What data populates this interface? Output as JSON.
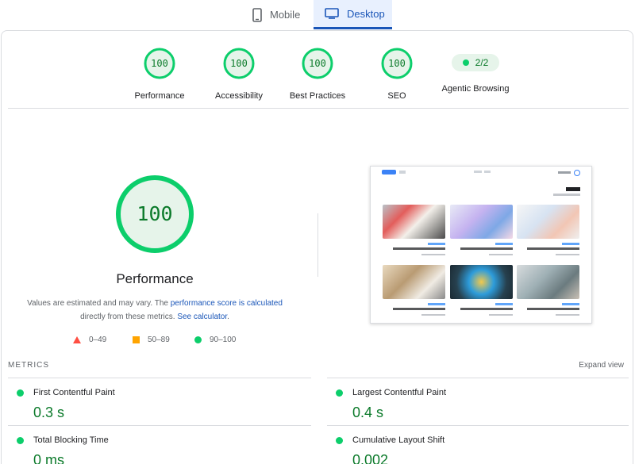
{
  "device_tabs": [
    {
      "label": "Mobile",
      "icon": "phone-icon",
      "selected": false
    },
    {
      "label": "Desktop",
      "icon": "monitor-icon",
      "selected": true
    }
  ],
  "categories": [
    {
      "label": "Performance",
      "score": "100"
    },
    {
      "label": "Accessibility",
      "score": "100"
    },
    {
      "label": "Best Practices",
      "score": "100"
    },
    {
      "label": "SEO",
      "score": "100"
    }
  ],
  "agentic": {
    "label": "Agentic Browsing",
    "value": "2/2"
  },
  "performance": {
    "score": "100",
    "title": "Performance",
    "note_prefix": "Values are estimated and may vary. The ",
    "note_link1": "performance score is calculated",
    "note_mid": " directly from these metrics. ",
    "note_link2": "See calculator",
    "note_suffix": "."
  },
  "legend": [
    {
      "label": "0–49",
      "shape": "triangle",
      "color": "#ff4e42"
    },
    {
      "label": "50–89",
      "shape": "square",
      "color": "#ffa400"
    },
    {
      "label": "90–100",
      "shape": "circle",
      "color": "#0cce6b"
    }
  ],
  "metrics": {
    "title": "METRICS",
    "expand_label": "Expand view",
    "items": [
      {
        "name": "First Contentful Paint",
        "value": "0.3 s"
      },
      {
        "name": "Largest Contentful Paint",
        "value": "0.4 s"
      },
      {
        "name": "Total Blocking Time",
        "value": "0 ms"
      },
      {
        "name": "Cumulative Layout Shift",
        "value": "0.002"
      }
    ]
  },
  "colors": {
    "pass_green": "#0cce6b",
    "score_text": "#0b7a2a",
    "accent_blue": "#1a56b8",
    "tab_bg": "#e8f0fe"
  }
}
